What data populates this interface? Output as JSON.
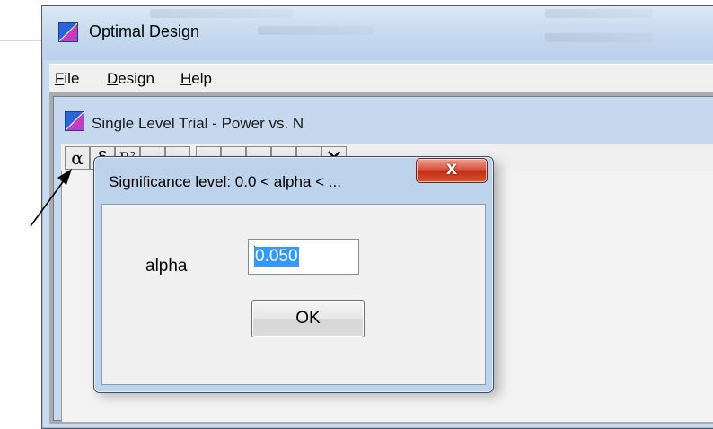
{
  "main_window": {
    "title": "Optimal Design",
    "icon": "optimal-design-app-icon",
    "menu": [
      {
        "label": "File",
        "mnemonic": "F",
        "rest": "ile"
      },
      {
        "label": "Design",
        "mnemonic": "D",
        "rest": "esign"
      },
      {
        "label": "Help",
        "mnemonic": "H",
        "rest": "elp"
      }
    ]
  },
  "child_window": {
    "title": "Single Level Trial - Power vs. N",
    "toolbar": [
      {
        "glyph": "α",
        "icon": "alpha-icon"
      },
      {
        "glyph": "δ",
        "icon": "delta-icon"
      },
      {
        "glyph": "R²",
        "icon": "r-squared-icon"
      },
      {
        "glyph": "",
        "icon": "toolbar-icon-4"
      },
      {
        "glyph": "",
        "icon": "toolbar-icon-5"
      },
      {
        "glyph": "",
        "icon": "toolbar-icon-6"
      },
      {
        "glyph": "",
        "icon": "toolbar-icon-7"
      },
      {
        "glyph": "",
        "icon": "toolbar-icon-8"
      },
      {
        "glyph": "",
        "icon": "toolbar-icon-9"
      },
      {
        "glyph": "",
        "icon": "toolbar-icon-10"
      },
      {
        "glyph": "✕",
        "icon": "close-x-icon"
      }
    ]
  },
  "dialog": {
    "title": "Significance level: 0.0 < alpha < ...",
    "close_label": "X",
    "field_label": "alpha",
    "field_value": "0.050",
    "ok_label": "OK"
  },
  "colors": {
    "title_bar": "#c3d7ee",
    "close_button": "#c1301b",
    "selection": "#3399ff"
  }
}
